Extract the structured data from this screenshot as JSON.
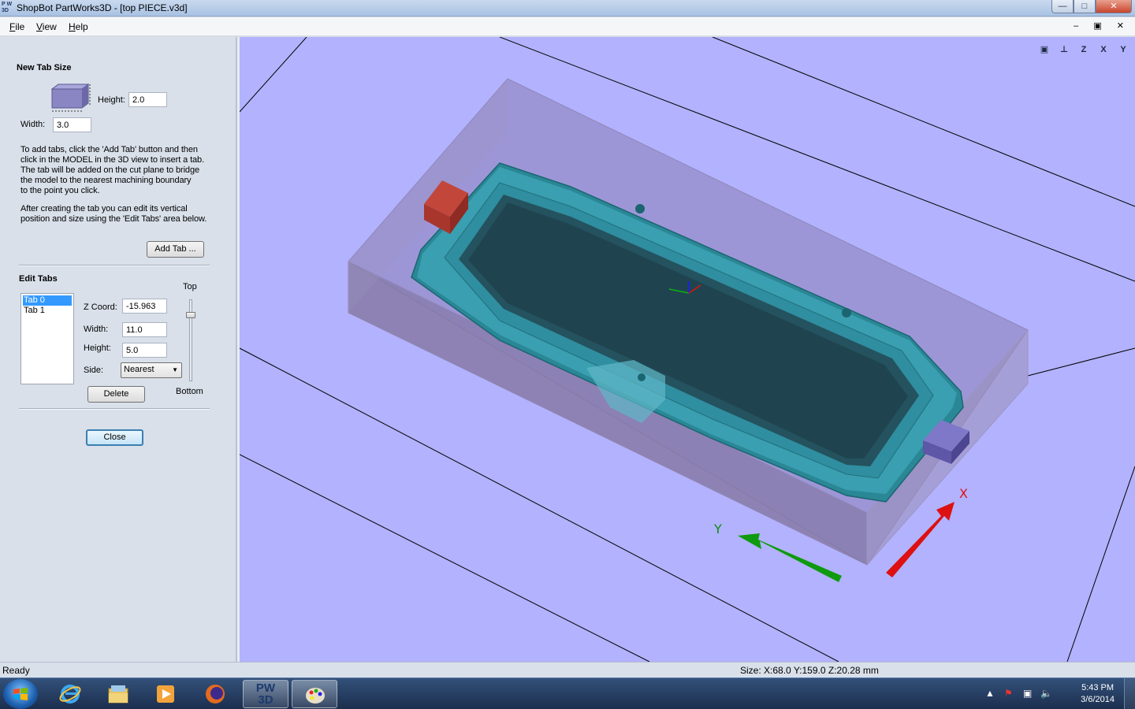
{
  "window": {
    "title": "ShopBot PartWorks3D - [top PIECE.v3d]",
    "logo": "PW 3D",
    "controls": {
      "minimize": "—",
      "maximize": "□",
      "close": "✕"
    }
  },
  "menu": {
    "items": [
      {
        "key": "F",
        "rest": "ile"
      },
      {
        "key": "V",
        "rest": "iew"
      },
      {
        "key": "H",
        "rest": "elp"
      }
    ],
    "mdi_controls": "– ▣ ✕"
  },
  "new_tab_size": {
    "heading": "New Tab Size",
    "height_label": "Height:",
    "height_value": "2.0",
    "width_label": "Width:",
    "width_value": "3.0",
    "help_1": "To add tabs, click the 'Add Tab' button and then\nclick in the MODEL in the 3D view to insert a tab.\nThe tab will be added on the cut plane to bridge\nthe model to the nearest machining boundary\nto the point you click.",
    "help_2": "After creating the tab you can edit its vertical\nposition and size using the 'Edit Tabs' area below.",
    "add_tab_label": "Add Tab ..."
  },
  "edit_tabs": {
    "heading": "Edit Tabs",
    "tabs": [
      "Tab 0",
      "Tab 1"
    ],
    "selected_index": 0,
    "z_label": "Z Coord:",
    "z_value": "-15.963",
    "width_label": "Width:",
    "width_value": "11.0",
    "height_label": "Height:",
    "height_value": "5.0",
    "side_label": "Side:",
    "side_value": "Nearest",
    "top_label": "Top",
    "bottom_label": "Bottom",
    "slider_position": 0.15,
    "delete_label": "Delete"
  },
  "close_label": "Close",
  "viewport": {
    "background": "#b2b2ff",
    "view_icons": [
      {
        "name": "zoom-extents-icon",
        "glyph": "▣"
      },
      {
        "name": "iso-view-icon",
        "glyph": "⊥"
      },
      {
        "name": "view-z-icon",
        "glyph": "Z"
      },
      {
        "name": "view-x-icon",
        "glyph": "X"
      },
      {
        "name": "view-y-icon",
        "glyph": "Y"
      }
    ],
    "axis_labels": {
      "x": "X",
      "y": "Y"
    },
    "colors": {
      "model": "#2f8fa0",
      "tab_red": "#b03a2e",
      "tab_blue": "#6a62b8",
      "x_arrow": "#dd1111",
      "y_arrow": "#0f9a0f"
    }
  },
  "status": {
    "left": "Ready",
    "right": "Size: X:68.0 Y:159.0 Z:20.28 mm"
  },
  "taskbar": {
    "time": "5:43 PM",
    "date": "3/6/2014",
    "pw_label": "PW 3D"
  }
}
